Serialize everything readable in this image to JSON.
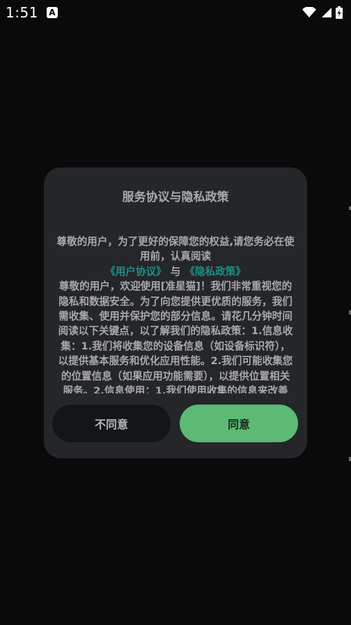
{
  "status_bar": {
    "time": "1:51",
    "notification_glyph": "A",
    "icons": [
      "wifi-icon",
      "signal-icon",
      "battery-charging-icon"
    ]
  },
  "dialog": {
    "title": "服务协议与隐私政策",
    "intro": "尊敬的用户，为了更好的保障您的权益,请您务必在使用前，认真阅读",
    "link_user_agreement": "《用户协议》",
    "and_text": "与",
    "link_privacy_policy": "《隐私政策》",
    "body_text": "尊敬的用户，欢迎使用[准星猫]！我们非常重视您的隐私和数据安全。为了向您提供更优质的服务，我们需收集、使用并保护您的部分信息。请花几分钟时间阅读以下关键点，以了解我们的隐私政策：1.信息收集：1.我们将收集您的设备信息（如设备标识符），以提供基本服务和优化应用性能。2.我们可能收集您的位置信息（如果应用功能需要），以提供位置相关服务。2.信息使用：1.我们使用收集的信息来改善",
    "cancel_label": "不同意",
    "agree_label": "同意"
  },
  "colors": {
    "background": "#0a0a0b",
    "dialog_bg": "#252629",
    "link": "#1b8f86",
    "agree_button": "#5cba74",
    "cancel_button": "#141517"
  }
}
